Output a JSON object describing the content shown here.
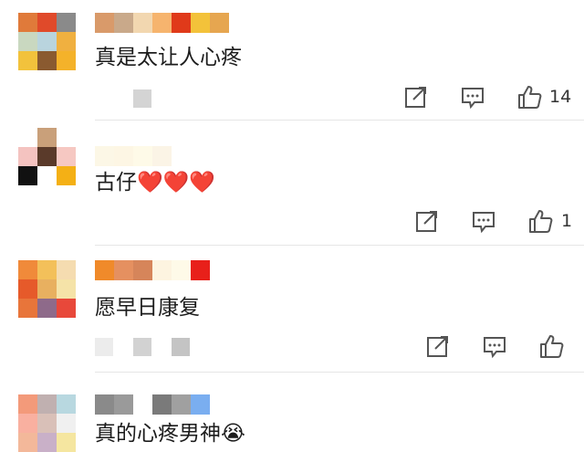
{
  "comments": [
    {
      "text": "真是太让人心疼",
      "like_count": "14",
      "avatar_colors": [
        "#e07a3a",
        "#e04a2a",
        "#8a8a8a",
        "#c9d8c0",
        "#b9d4de",
        "#f0b040",
        "#f2c23c",
        "#8a5a30",
        "#f4b22a"
      ],
      "name_colors": [
        "#d99a6a",
        "#c9a98a",
        "#f2d7b0",
        "#f6b46e",
        "#e03a1a",
        "#f3c23a",
        "#e6a650"
      ]
    },
    {
      "text": "古仔",
      "emoji": "❤️❤️❤️",
      "like_count": "1",
      "avatar_colors": [
        "#ffffff",
        "#c9a07a",
        "#ffffff",
        "#f4c3c0",
        "#5a3a2a",
        "#f6c8c2",
        "#111111",
        "#ffffff",
        "#f4b015"
      ],
      "name_colors": [
        "#fcf7e6",
        "#fdf6e4",
        "#fefae8",
        "#fbf4e6"
      ]
    },
    {
      "text": "愿早日康复",
      "like_count": "",
      "avatar_colors": [
        "#f08a3a",
        "#f3c05a",
        "#f5dcb0",
        "#e65a2a",
        "#e8b060",
        "#f5e3a8",
        "#e8753a",
        "#8e6a8a",
        "#e8483a"
      ],
      "name_colors": [
        "#f08a2a",
        "#e59060",
        "#d6855a",
        "#fdf4e0",
        "#fefae8",
        "#e8201a"
      ]
    },
    {
      "text": "真的心疼男神",
      "emoji": "😭",
      "like_count": "",
      "avatar_colors": [
        "#f39a7a",
        "#c0b0b0",
        "#b8d8e0",
        "#f9b0a0",
        "#d9c0b8",
        "#f0f0f0",
        "#f3b89a",
        "#c9b0c8",
        "#f5e6a0"
      ],
      "name_colors": [
        "#8a8a8a",
        "#9a9a9a",
        "#ffffff",
        "#7a7a7a",
        "#a0a0a0",
        "#7aaef0"
      ]
    }
  ],
  "action_icons": [
    "share-icon",
    "comment-icon",
    "like-icon"
  ]
}
